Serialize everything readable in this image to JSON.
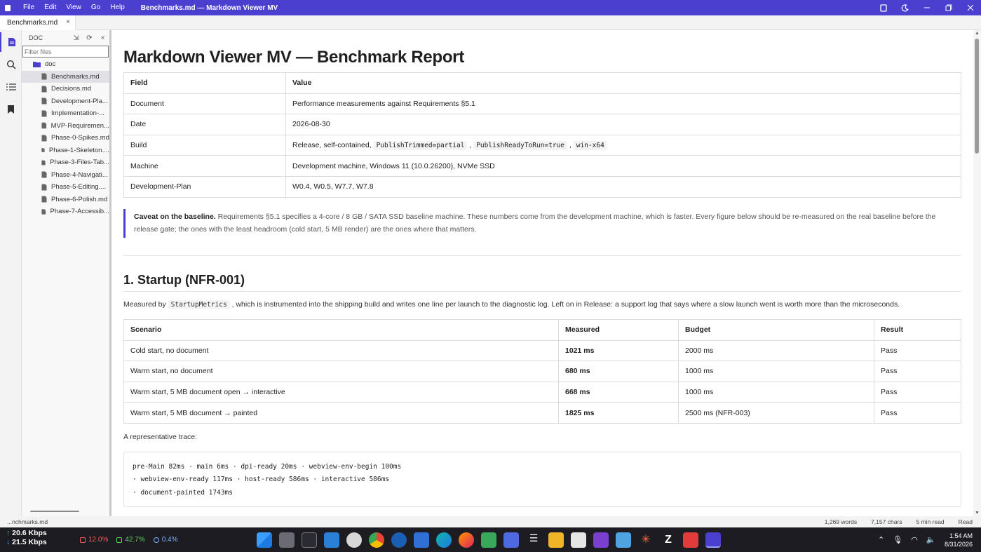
{
  "titlebar": {
    "menu": [
      "File",
      "Edit",
      "View",
      "Go",
      "Help"
    ],
    "window_title": "Benchmarks.md — Markdown Viewer MV"
  },
  "tab": {
    "label": "Benchmarks.md",
    "close": "×"
  },
  "sidebar": {
    "header": "DOC",
    "filter_placeholder": "Filter files",
    "folder": "doc",
    "files": [
      "Benchmarks.md",
      "Decisions.md",
      "Development-Pla...",
      "Implementation-...",
      "MVP-Requiremen...",
      "Phase-0-Spikes.md",
      "Phase-1-Skeleton....",
      "Phase-3-Files-Tab...",
      "Phase-4-Navigati...",
      "Phase-5-Editing....",
      "Phase-6-Polish.md",
      "Phase-7-Accessib..."
    ],
    "selected_index": 0
  },
  "doc": {
    "title": "Markdown Viewer MV — Benchmark Report",
    "meta_headers": [
      "Field",
      "Value"
    ],
    "meta_rows": [
      {
        "field": "Document",
        "value": "Performance measurements against Requirements §5.1"
      },
      {
        "field": "Date",
        "value": "2026-08-30"
      },
      {
        "field": "Build",
        "value_prefix": "Release, self-contained, ",
        "code1": "PublishTrimmed=partial",
        "sep1": " , ",
        "code2": "PublishReadyToRun=true",
        "sep2": " , ",
        "code3": "win-x64"
      },
      {
        "field": "Machine",
        "value": "Development machine, Windows 11 (10.0.26200), NVMe SSD"
      },
      {
        "field": "Development-Plan",
        "value": "W0.4, W0.5, W7.7, W7.8"
      }
    ],
    "caveat_bold": "Caveat on the baseline.",
    "caveat_text": " Requirements §5.1 specifies a 4-core / 8 GB / SATA SSD baseline machine. These numbers come from the development machine, which is faster. Every figure below should be re-measured on the real baseline before the release gate; the ones with the least headroom (cold start, 5 MB render) are the ones where that matters.",
    "section1_title": "1. Startup (NFR-001)",
    "section1_pre": "Measured by ",
    "section1_code": "StartupMetrics",
    "section1_post": " , which is instrumented into the shipping build and writes one line per launch to the diagnostic log. Left on in Release: a support log that says where a slow launch went is worth more than the microseconds.",
    "results_headers": [
      "Scenario",
      "Measured",
      "Budget",
      "Result"
    ],
    "results_rows": [
      {
        "scenario": "Cold start, no document",
        "measured": "1021 ms",
        "budget": "2000 ms",
        "result": "Pass"
      },
      {
        "scenario": "Warm start, no document",
        "measured": "680 ms",
        "budget": "1000 ms",
        "result": "Pass"
      },
      {
        "scenario": "Warm start, 5 MB document open → interactive",
        "measured": "668 ms",
        "budget": "1000 ms",
        "result": "Pass"
      },
      {
        "scenario": "Warm start, 5 MB document → painted",
        "measured": "1825 ms",
        "budget": "2500 ms (NFR-003)",
        "result": "Pass"
      }
    ],
    "trace_intro": "A representative trace:",
    "trace_lines": [
      "pre-Main 82ms · main 6ms · dpi-ready 20ms · webview-env-begin 100ms",
      "· webview-env-ready 117ms · host-ready 586ms · interactive 586ms",
      "· document-painted 1743ms"
    ]
  },
  "statusbar": {
    "path": "...nchmarks.md",
    "words": "1,269 words",
    "chars": "7,157 chars",
    "read_time": "5 min read",
    "mode": "Read"
  },
  "taskbar": {
    "net_down": "20.6 Kbps",
    "net_up": "21.5 Kbps",
    "cpu": "12.0%",
    "mem": "42.7%",
    "gpu": "0.4%",
    "time": "1:54 AM",
    "date": "8/31/2026"
  },
  "colors": {
    "accent": "#4b3fcf",
    "taskbar": "#1c1c22"
  }
}
